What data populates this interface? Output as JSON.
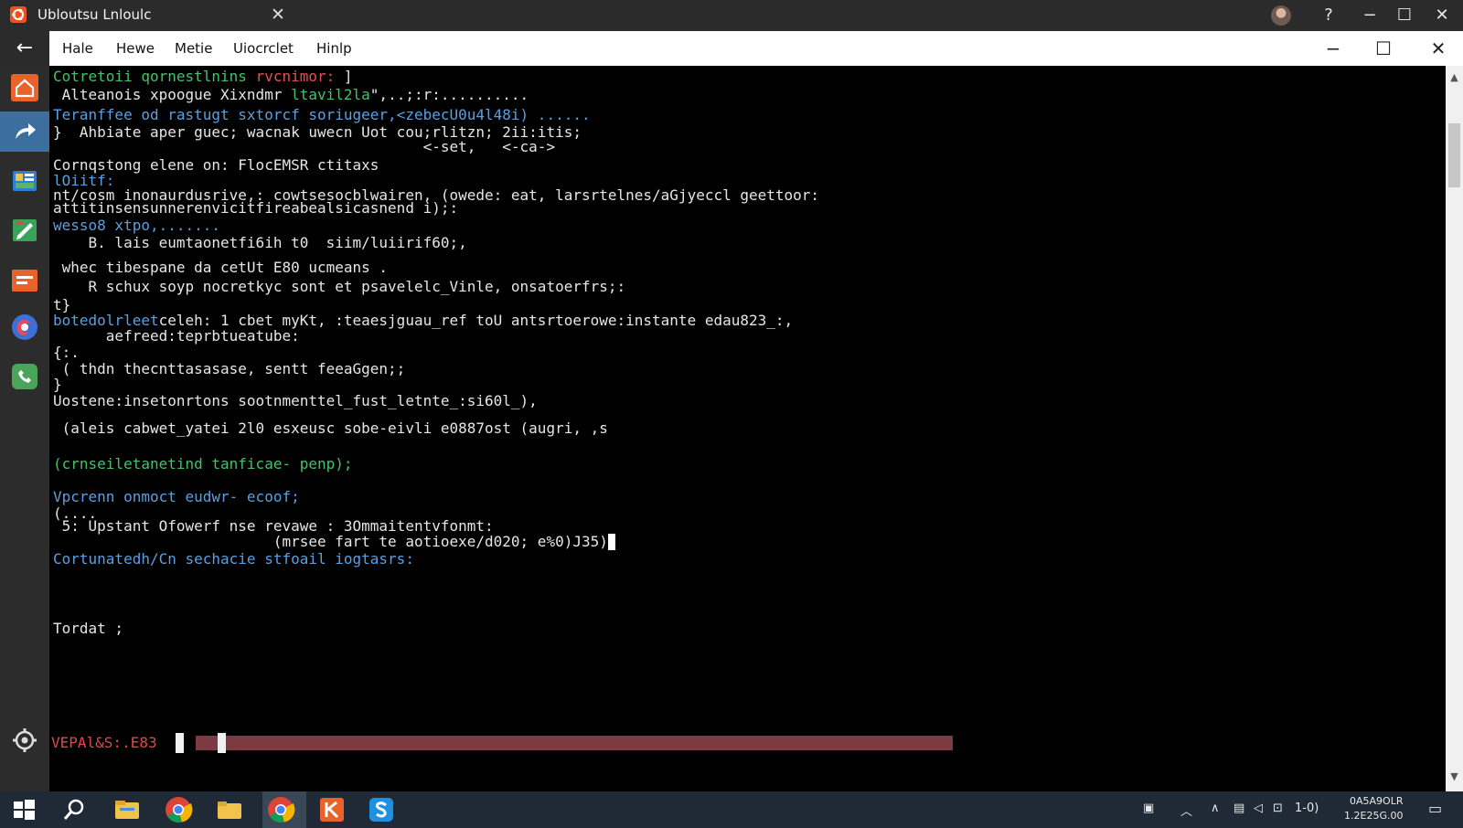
{
  "window": {
    "title": "Ubloutsu Lnloulc",
    "tab_close": "✕",
    "help": "?",
    "minimize": "−",
    "maximize": "☐",
    "close": "✕"
  },
  "menu": {
    "back": "←",
    "items": [
      {
        "label": "Hale"
      },
      {
        "label": "Hewe"
      },
      {
        "label": "Metie"
      },
      {
        "label": "Uiocrclet"
      },
      {
        "label": "Hinlp"
      }
    ],
    "minimize": "−",
    "maximize": "☐",
    "close": "✕"
  },
  "terminal": {
    "lines": [
      {
        "text": "Cotretoii qornestlnins ",
        "color": "green",
        "extra": "rvcnimor:",
        "extra_color": "red",
        "tail": " ]"
      },
      {
        "text": " Alteanois xpoogue Xixndmr ",
        "color": "white",
        "extra": "ltavil2la",
        "extra_color": "green",
        "tail": "\",..;:r:.........."
      },
      {
        "text": "Teranffee od rastugt sxtorcf soriugeer,<zebecU0u4l48i) ......",
        "color": "white"
      },
      {
        "text": "}  Ahbiate aper guec; wacnak uwecn Uot cou;rlitzn; 2ii:itis;",
        "color": "white"
      },
      {
        "text": "                                          <-set,   <-ca->",
        "color": "white"
      },
      {
        "text": "Cornqstong elene on: FlocEMSR ctitaxs",
        "color": "white"
      },
      {
        "text": "lOiitf:",
        "color": "blue"
      },
      {
        "text": "nt/cosm inonaurdusrive,: cowtsesocblwairen, (owede: eat, larsrtelnes/aGjyeccl geettoor:",
        "color": "white"
      },
      {
        "text": "attitinsensunnerenvicitfireabealsicasnend i);:",
        "color": "white"
      },
      {
        "text": "wesso8 xtpo,.......",
        "color": "blue",
        "tail_plain": ""
      },
      {
        "text": "    B. lais eumtaonetfi6ih t0  siim/luiirif60;,",
        "color": "white"
      },
      {
        "text": " whec tibespane da cetUt E80 ucmeans .",
        "color": "white"
      },
      {
        "text": "    R schux soyp nocretkyc sont et psavelelc_Vinle, onsatoerfrs;:",
        "color": "white"
      },
      {
        "text": "t}",
        "color": "white"
      },
      {
        "text": "botedolrleet",
        "color": "blue",
        "tail": "celeh: 1 cbet myKt, :teaesjguau_ref toU antsrtoerowe:instante edau823_:,"
      },
      {
        "text": "      aefreed:teprbtueatube:",
        "color": "white"
      },
      {
        "text": "{:.",
        "color": "white"
      },
      {
        "text": " ( thdn thecnttasasase, sentt feeaGgen;;",
        "color": "white"
      },
      {
        "text": "}",
        "color": "white"
      },
      {
        "text": "Uostene:insetonrtons sootnmenttel_fust_letnte_:si60l_),",
        "color": "white"
      },
      {
        "text": " (aleis cabwet_yatei 2l0 esxeusc sobe-eivli e0887ost (augri, ,s",
        "color": "white"
      },
      {
        "text": "(crnseiletanetind tanficae- penp);",
        "color": "green"
      },
      {
        "text": "Vpcrenn onmoct eudwr- ecoof;",
        "color": "blue"
      },
      {
        "text": "(....",
        "color": "white"
      },
      {
        "text": " 5: Upstant Ofowerf nse revawe : 3Ommaitentvfonmt:",
        "color": "white"
      },
      {
        "text": "                         (mrsee fart te aotioexe/d020; e%0)J35)",
        "color": "white",
        "cursor": true
      },
      {
        "text": "Cortunatedh/Cn sechacie stfoail iogtasrs:",
        "color": "blue",
        "tail_plain": ""
      },
      {
        "text": "Tordat ;",
        "color": "white"
      }
    ],
    "status": "VEPAl&S:.E83"
  },
  "taskbar": {
    "tray_time": "0A5A9OLR",
    "tray_date": "1.2E25G.00",
    "tray_lang": "1-0)"
  },
  "colors": {
    "green": "#44c26a",
    "blue": "#5aa0e0",
    "red": "#e65050",
    "status_bar": "#7b3b42"
  },
  "icons": {
    "app": "ubuntu-logo-icon",
    "sidebar": [
      "home-icon",
      "share-icon",
      "files-icon",
      "edit-icon",
      "presentation-icon",
      "browser-icon",
      "phone-icon",
      "settings-icon"
    ],
    "taskbar": [
      "windows-start-icon",
      "search-icon",
      "file-explorer-icon",
      "chrome-icon",
      "folder-icon",
      "chrome-icon",
      "app-k-icon",
      "skype-icon"
    ]
  }
}
